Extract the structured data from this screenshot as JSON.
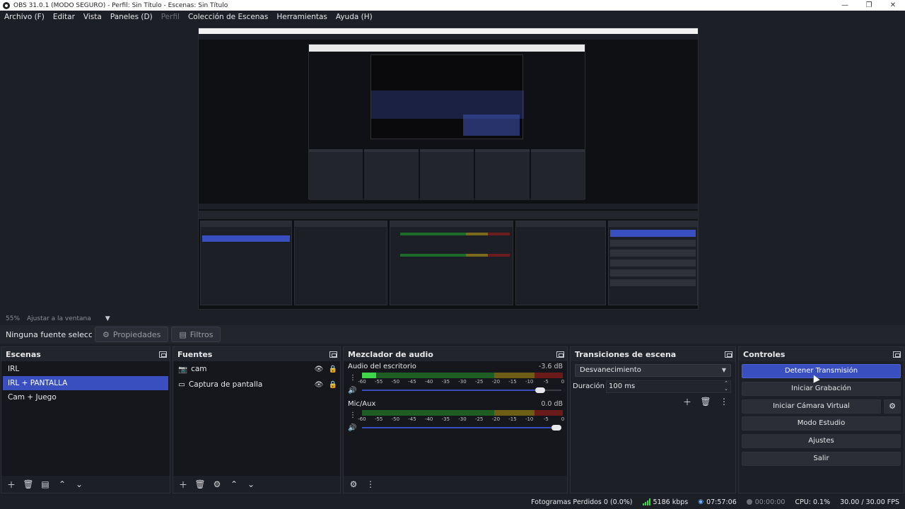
{
  "window": {
    "title": "OBS 31.0.1 (MODO SEGURO) - Perfil: Sin Título - Escenas: Sin Título"
  },
  "menu": [
    {
      "label": "Archivo (F)",
      "enabled": true
    },
    {
      "label": "Editar",
      "enabled": true
    },
    {
      "label": "Vista",
      "enabled": true
    },
    {
      "label": "Paneles (D)",
      "enabled": true
    },
    {
      "label": "Perfil",
      "enabled": false
    },
    {
      "label": "Colección de Escenas",
      "enabled": true
    },
    {
      "label": "Herramientas",
      "enabled": true
    },
    {
      "label": "Ayuda (H)",
      "enabled": true
    }
  ],
  "zoom": {
    "percent": "55%",
    "fit_label": "Ajustar a la ventana"
  },
  "context": {
    "no_source": "Ninguna fuente seleccionada",
    "properties": "Propiedades",
    "filters": "Filtros"
  },
  "scenes": {
    "title": "Escenas",
    "items": [
      {
        "label": "IRL",
        "selected": false
      },
      {
        "label": "IRL + PANTALLA",
        "selected": true
      },
      {
        "label": "Cam + Juego",
        "selected": false
      }
    ]
  },
  "sources": {
    "title": "Fuentes",
    "items": [
      {
        "label": "cam",
        "icon": "camera-icon"
      },
      {
        "label": "Captura de pantalla",
        "icon": "monitor-icon"
      }
    ]
  },
  "mixer": {
    "title": "Mezclador de audio",
    "channels": [
      {
        "name": "Audio del escritorio",
        "db": "-3.6 dB",
        "level": 0.07,
        "volume": 0.92
      },
      {
        "name": "Mic/Aux",
        "db": "0.0 dB",
        "level": 0.0,
        "volume": 1.0
      }
    ],
    "ticks": [
      "-60",
      "-55",
      "-50",
      "-45",
      "-40",
      "-35",
      "-30",
      "-25",
      "-20",
      "-15",
      "-10",
      "-5",
      "0"
    ]
  },
  "transitions": {
    "title": "Transiciones de escena",
    "selected": "Desvanecimiento",
    "duration_label": "Duración",
    "duration_value": "100 ms"
  },
  "controls": {
    "title": "Controles",
    "buttons": [
      {
        "label": "Detener Transmisión",
        "active": true
      },
      {
        "label": "Iniciar Grabación",
        "active": false
      },
      {
        "label": "Iniciar Cámara Virtual",
        "active": false
      },
      {
        "label": "Modo Estudio",
        "active": false
      },
      {
        "label": "Ajustes",
        "active": false
      },
      {
        "label": "Salir",
        "active": false
      }
    ]
  },
  "status": {
    "dropped": "Fotogramas Perdidos 0 (0.0%)",
    "bitrate": "5186 kbps",
    "stream_time": "07:57:06",
    "rec_time": "00:00:00",
    "cpu": "CPU: 0.1%",
    "fps": "30.00 / 30.00 FPS"
  },
  "colors": {
    "accent": "#3a4fbf",
    "meter_green": "#3fd64a",
    "panel": "#1d1f26"
  }
}
